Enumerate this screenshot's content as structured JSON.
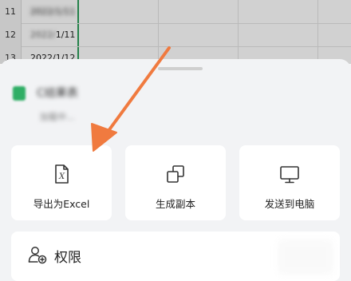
{
  "sheet": {
    "rows": [
      {
        "num": "11",
        "value": "2022/1/11",
        "blurred": true
      },
      {
        "num": "12",
        "value": "2022/1/11",
        "blurred": true
      },
      {
        "num": "13",
        "value": "2022/1/12",
        "blurred": false
      }
    ]
  },
  "file": {
    "name": "C结果表",
    "meta": "加载中..."
  },
  "actions": [
    {
      "label": "导出为Excel",
      "icon": "excel-file-icon"
    },
    {
      "label": "生成副本",
      "icon": "copy-icon"
    },
    {
      "label": "发送到电脑",
      "icon": "monitor-icon"
    }
  ],
  "permission": {
    "label": "权限",
    "icon": "user-permission-icon"
  },
  "colors": {
    "accent_arrow": "#f07a3f",
    "sheet_selection": "#2e9e5b",
    "file_icon": "#2fae65"
  }
}
